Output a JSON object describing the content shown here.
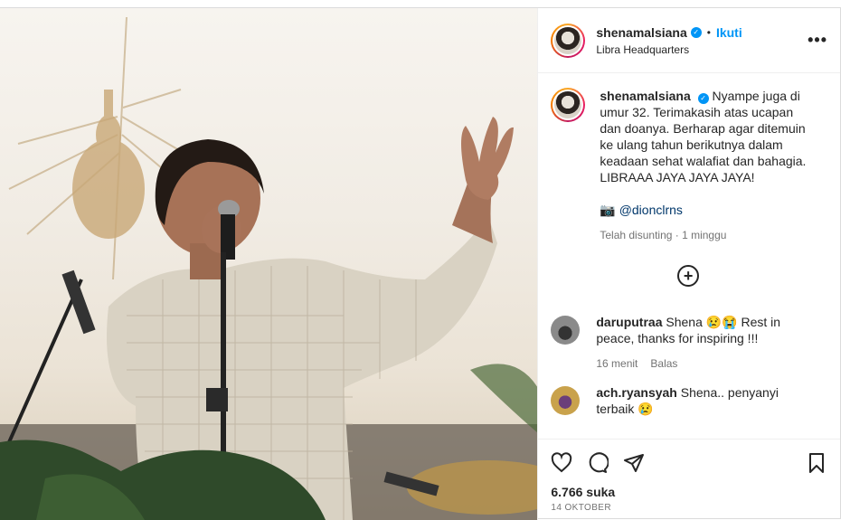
{
  "post": {
    "username": "shenamalsiana",
    "follow_label": "Ikuti",
    "dot": "•",
    "location": "Libra Headquarters",
    "more_label": "•••"
  },
  "caption": {
    "username": "shenamalsiana",
    "text": "Nyampe juga di umur 32. Terimakasih atas ucapan dan doanya. Berharap agar ditemuin ke ulang tahun berikutnya dalam keadaan sehat walafiat dan bahagia. LIBRAAA JAYA JAYA JAYA!",
    "camera_emoji": "📷",
    "mention": "@dionclrns",
    "edited": "Telah disunting · 1 minggu"
  },
  "comments": [
    {
      "username": "daruputraa",
      "text": "Shena 😢😭 Rest in peace, thanks for inspiring !!!",
      "time": "16 menit",
      "reply_label": "Balas",
      "avatar_color": "#8a8a8a"
    },
    {
      "username": "ach.ryansyah",
      "text": "Shena.. penyanyi terbaik 😢",
      "avatar_color": "#c9a24c"
    }
  ],
  "footer": {
    "likes": "6.766 suka",
    "date": "14 OKTOBER"
  },
  "icons": {
    "like": "heart-icon",
    "comment": "comment-icon",
    "share": "share-icon",
    "save": "bookmark-icon",
    "add": "plus-circle-icon",
    "verified": "verified-badge-icon"
  },
  "colors": {
    "accent": "#0095f6",
    "text": "#262626",
    "muted": "#737373"
  }
}
